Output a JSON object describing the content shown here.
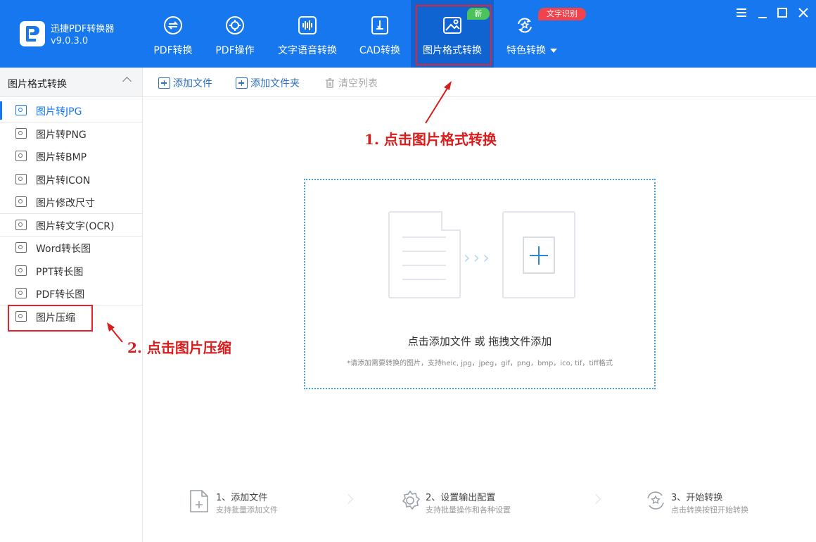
{
  "app": {
    "name": "迅捷PDF转换器",
    "version": "v9.0.3.0"
  },
  "nav": [
    {
      "label": "PDF转换",
      "icon": "pdf-convert-icon"
    },
    {
      "label": "PDF操作",
      "icon": "pdf-operate-icon"
    },
    {
      "label": "文字语音转换",
      "icon": "voice-icon"
    },
    {
      "label": "CAD转换",
      "icon": "cad-icon"
    },
    {
      "label": "图片格式转换",
      "icon": "image-icon",
      "active": true,
      "badge": "新"
    },
    {
      "label": "特色转换",
      "icon": "refresh-star-icon",
      "badge": "文字识别"
    }
  ],
  "sidebar": {
    "title": "图片格式转换",
    "items": [
      {
        "label": "图片转JPG",
        "active": true
      },
      {
        "label": "图片转PNG"
      },
      {
        "label": "图片转BMP"
      },
      {
        "label": "图片转ICON"
      },
      {
        "label": "图片修改尺寸"
      },
      {
        "label": "图片转文字(OCR)"
      },
      {
        "label": "Word转长图"
      },
      {
        "label": "PPT转长图"
      },
      {
        "label": "PDF转长图"
      },
      {
        "label": "图片压缩"
      }
    ]
  },
  "toolbar": {
    "add_file": "添加文件",
    "add_folder": "添加文件夹",
    "clear_list": "清空列表"
  },
  "dropzone": {
    "main_text": "点击添加文件 或 拖拽文件添加",
    "hint": "*请添加需要转换的图片，支持heic, jpg，jpeg，gif，png，bmp，ico, tif，tiff格式"
  },
  "annotations": {
    "step1": "1. 点击图片格式转换",
    "step2": "2. 点击图片压缩"
  },
  "steps": [
    {
      "title": "1、添加文件",
      "sub": "支持批量添加文件"
    },
    {
      "title": "2、设置输出配置",
      "sub": "支持批量操作和各种设置"
    },
    {
      "title": "3、开始转换",
      "sub": "点击转换按钮开始转换"
    }
  ],
  "colors": {
    "brand": "#1677ee",
    "active_nav": "#0f64d1",
    "annotation": "#e8222c",
    "badge_new": "#4cc35a",
    "badge_ocr": "#f0434b"
  }
}
